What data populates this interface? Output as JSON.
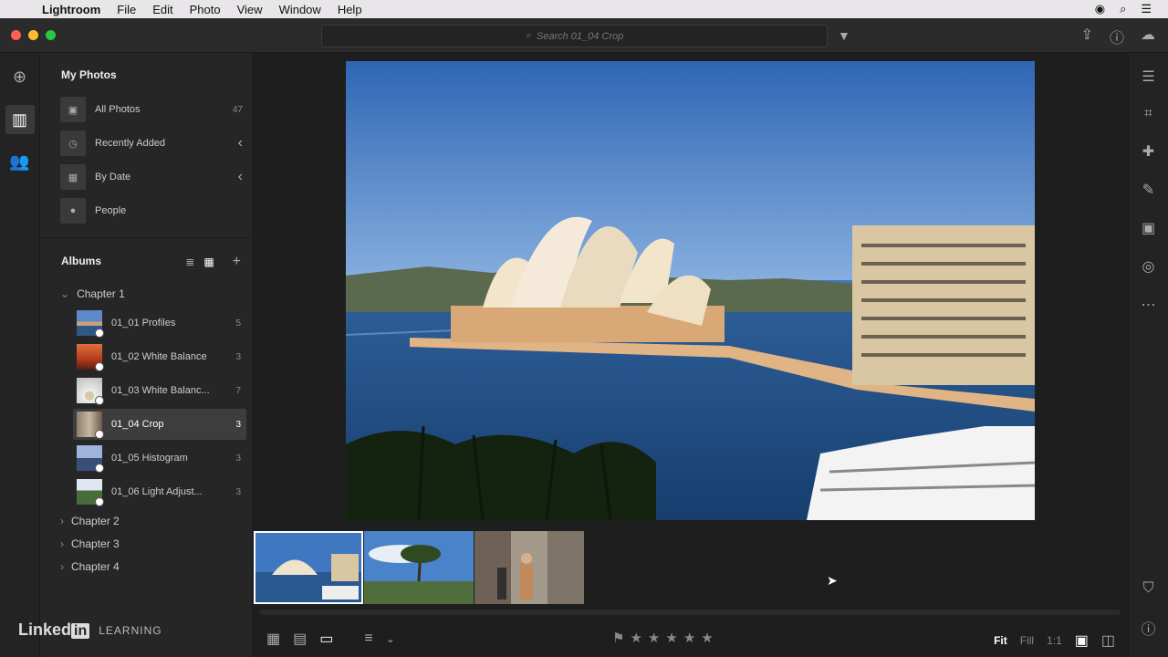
{
  "menubar": {
    "apple_icon": "apple-icon",
    "app": "Lightroom",
    "items": [
      "File",
      "Edit",
      "Photo",
      "View",
      "Window",
      "Help"
    ]
  },
  "titlebar": {
    "search_placeholder": "Search 01_04 Crop"
  },
  "my_photos": {
    "title": "My Photos",
    "items": [
      {
        "label": "All Photos",
        "meta": "47",
        "icon": "photo-icon"
      },
      {
        "label": "Recently Added",
        "meta": "‹",
        "icon": "clock-icon"
      },
      {
        "label": "By Date",
        "meta": "‹",
        "icon": "calendar-icon"
      },
      {
        "label": "People",
        "meta": "",
        "icon": "person-icon"
      }
    ]
  },
  "albums": {
    "title": "Albums",
    "chapters": [
      "Chapter 1",
      "Chapter 2",
      "Chapter 3",
      "Chapter 4"
    ],
    "items": [
      {
        "label": "01_01 Profiles",
        "count": "5"
      },
      {
        "label": "01_02 White Balance",
        "count": "3"
      },
      {
        "label": "01_03 White Balanc...",
        "count": "7"
      },
      {
        "label": "01_04 Crop",
        "count": "3"
      },
      {
        "label": "01_05 Histogram",
        "count": "3"
      },
      {
        "label": "01_06 Light Adjust...",
        "count": "3"
      }
    ],
    "selected_index": 3
  },
  "branding": {
    "linked": "Linked",
    "in": "in",
    "learning": "LEARNING"
  },
  "bottombar": {
    "zoom_fit": "Fit",
    "zoom_fill": "Fill",
    "zoom_1to1": "1:1",
    "rating": 0
  },
  "colors": {
    "accent": "#ffffff",
    "panel": "#262626",
    "background": "#1e1e1e",
    "close": "#ff5f57",
    "minimize": "#febc2e",
    "zoom": "#28c840"
  }
}
